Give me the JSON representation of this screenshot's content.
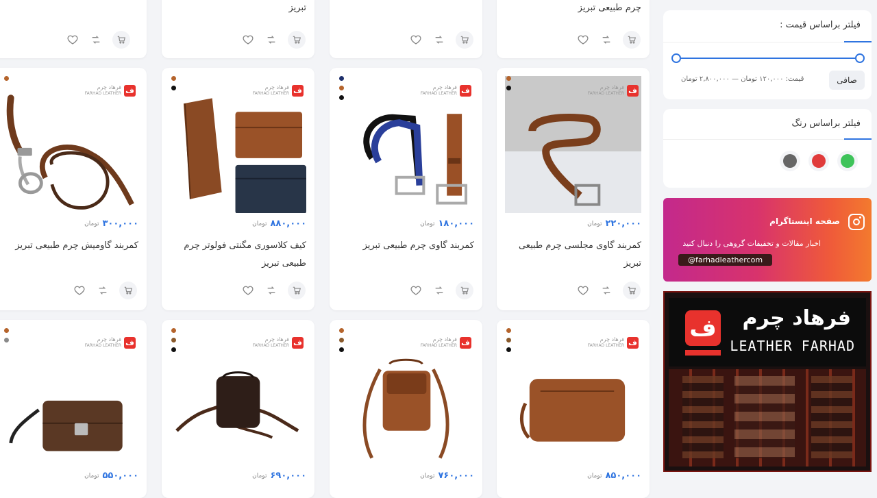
{
  "top_row": [
    {
      "name": "",
      "col": 0
    },
    {
      "name": "تبریز",
      "col": 1
    },
    {
      "name": "",
      "col": 2
    },
    {
      "name": "چرم طبیعی تبریز",
      "col": 3
    }
  ],
  "brand": {
    "name_fa": "فرهاد چرم",
    "name_en": "FARHAD LEATHER",
    "mark": "ف",
    "color": "#e8322d"
  },
  "currency": "تومان",
  "products_row2": [
    {
      "name": "کمربند گاومیش چرم طبیعی تبریز",
      "price": "۳۰۰,۰۰۰",
      "colors": [
        "#b5642c"
      ]
    },
    {
      "name": "کیف کلاسوری مگنتی فولوتر چرم طبیعی تبریز",
      "price": "۸۸۰,۰۰۰",
      "colors": [
        "#b5642c",
        "#111111"
      ]
    },
    {
      "name": "کمربند گاوی چرم طبیعی تبریز",
      "price": "۱۸۰,۰۰۰",
      "colors": [
        "#1e2f6b",
        "#b5642c",
        "#111111"
      ]
    },
    {
      "name": "کمربند گاوی مجلسی چرم طبیعی تبریز",
      "price": "۲۲۰,۰۰۰",
      "colors": [
        "#b5642c",
        "#111111"
      ]
    }
  ],
  "products_row3": [
    {
      "price": "۵۵۰,۰۰۰",
      "colors": [
        "#b5642c",
        "#8a8a8a"
      ]
    },
    {
      "price": "۶۹۰,۰۰۰",
      "colors": [
        "#b5642c",
        "#8a5a2c",
        "#111111"
      ]
    },
    {
      "price": "۷۶۰,۰۰۰",
      "colors": [
        "#b5642c",
        "#8a5a2c",
        "#111111"
      ]
    },
    {
      "price": "۸۵۰,۰۰۰",
      "colors": [
        "#b5642c",
        "#8a5a2c",
        "#111111"
      ]
    }
  ],
  "price_filter": {
    "title": "فیلتر براساس قیمت :",
    "range_label": "قیمت: ۱۲۰,۰۰۰ تومان — ۲,۸۰۰,۰۰۰ تومان",
    "button": "صافی",
    "accent": "#2f74e0"
  },
  "color_filter": {
    "title": "فیلتر براساس رنگ",
    "swatches": [
      "#3ec35a",
      "#e03b3b",
      "#666666"
    ]
  },
  "instagram": {
    "title": "صفحه اینستاگرام",
    "desc": "اخبار مقالات و تخفیفات گروهی را دنبال کنید",
    "handle": "@farhadleathercom"
  },
  "store_banner": {
    "sign_fa": "فرهاد چرم",
    "sign_en": "LEATHER FARHAD"
  }
}
